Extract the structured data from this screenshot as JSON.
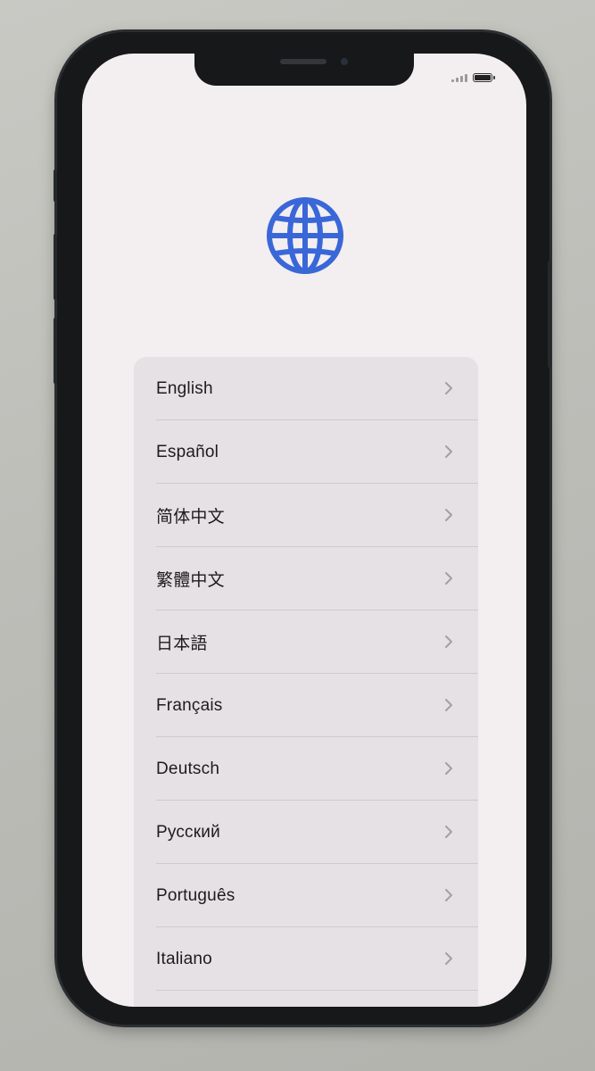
{
  "status_bar": {
    "signal_icon": "cellular-signal-icon",
    "battery_icon": "battery-icon"
  },
  "header": {
    "icon": "globe-icon",
    "icon_color": "#3a67d8"
  },
  "languages": [
    {
      "label": "English"
    },
    {
      "label": "Español"
    },
    {
      "label": "简体中文"
    },
    {
      "label": "繁體中文"
    },
    {
      "label": "日本語"
    },
    {
      "label": "Français"
    },
    {
      "label": "Deutsch"
    },
    {
      "label": "Русский"
    },
    {
      "label": "Português"
    },
    {
      "label": "Italiano"
    }
  ],
  "row_icon": "chevron-right-icon"
}
